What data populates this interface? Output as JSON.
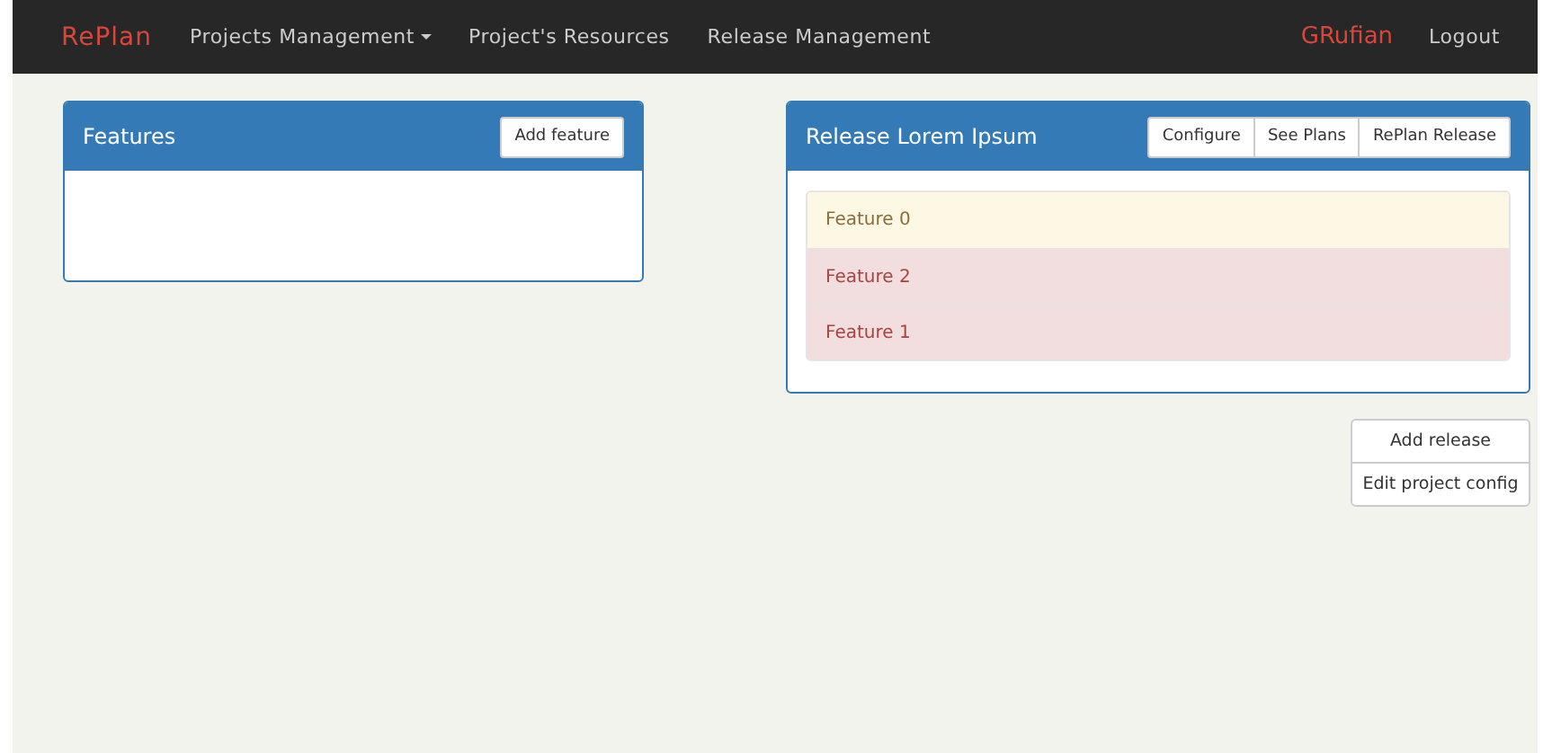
{
  "navbar": {
    "brand": "RePlan",
    "menu": [
      {
        "label": "Projects Management",
        "dropdown": true
      },
      {
        "label": "Project's Resources",
        "dropdown": false
      },
      {
        "label": "Release Management",
        "dropdown": false
      }
    ],
    "user": "GRufian",
    "logout": "Logout"
  },
  "features_panel": {
    "title": "Features",
    "button": "Add feature"
  },
  "release_panel": {
    "title": "Release Lorem Ipsum",
    "buttons": [
      "Configure",
      "See Plans",
      "RePlan Release"
    ],
    "features": [
      {
        "name": "Feature 0",
        "kind": "warning"
      },
      {
        "name": "Feature 2",
        "kind": "danger"
      },
      {
        "name": "Feature 1",
        "kind": "danger"
      }
    ]
  },
  "actions": [
    "Add release",
    "Edit project config"
  ]
}
